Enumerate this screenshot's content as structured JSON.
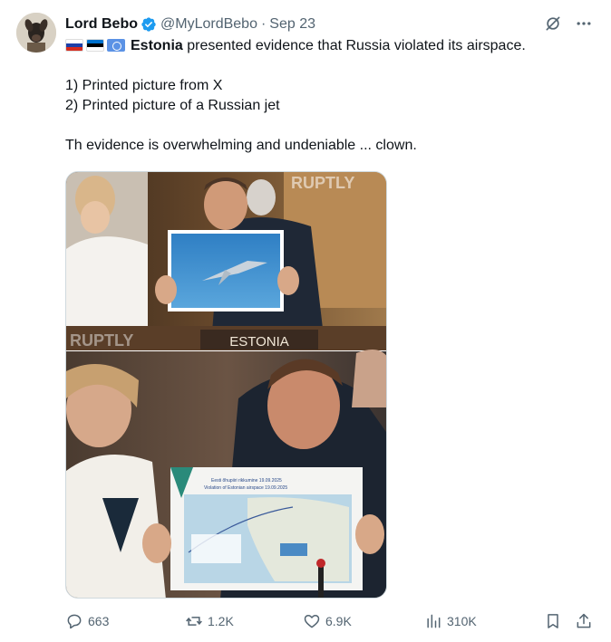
{
  "author": {
    "name": "Lord Bebo",
    "handle": "@MyLordBebo",
    "separator": "·",
    "date": "Sep 23"
  },
  "post": {
    "mention": "Estonia",
    "line1_rest": " presented evidence that Russia violated its airspace.",
    "list": [
      "1) Printed picture from X",
      "2) Printed picture of a Russian jet"
    ],
    "closing": "Th evidence is overwhelming and undeniable ... clown."
  },
  "media": {
    "watermark": "RUPTLY",
    "nameplate": "ESTONIA",
    "map_title_1": "Eesti õhupiiri rikkumine 19.09.2025",
    "map_title_2": "Violation of Estonian airspace 19.09.2025"
  },
  "actions": {
    "replies": "663",
    "reposts": "1.2K",
    "likes": "6.9K",
    "views": "310K"
  },
  "colors": {
    "text": "#0f1419",
    "secondary": "#536471",
    "verified": "#1d9bf0",
    "border": "#cfd9de"
  }
}
